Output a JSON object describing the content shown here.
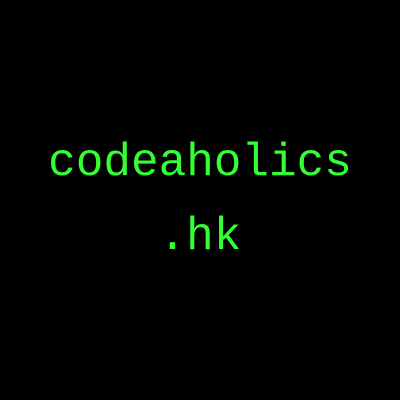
{
  "logo": {
    "line1": "codeaholics",
    "line2": ".hk",
    "text_color": "#33ff33",
    "background_color": "#000000"
  }
}
